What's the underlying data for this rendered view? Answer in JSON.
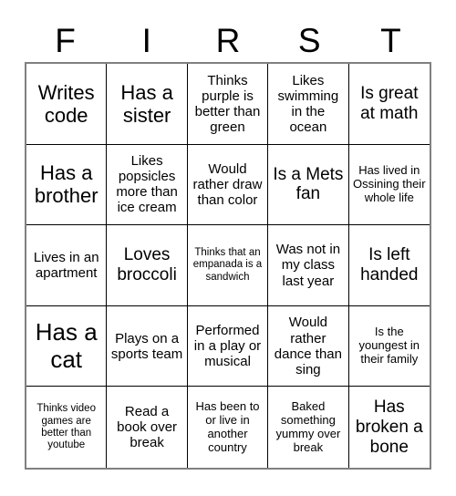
{
  "card": {
    "title_letters": [
      "F",
      "I",
      "R",
      "S",
      "T"
    ],
    "colors": {
      "background": "#ffffff",
      "text": "#000000",
      "cell_border": "#000000",
      "outer_border": "#808080"
    },
    "grid": {
      "columns": 5,
      "rows": 5,
      "cells": [
        {
          "text": "Writes code",
          "size": "lg"
        },
        {
          "text": "Has a sister",
          "size": "lg"
        },
        {
          "text": "Thinks purple is better than green",
          "size": "sm"
        },
        {
          "text": "Likes swimming in the ocean",
          "size": "sm"
        },
        {
          "text": "Is great at math",
          "size": "md"
        },
        {
          "text": "Has a brother",
          "size": "lg"
        },
        {
          "text": "Likes popsicles more than ice cream",
          "size": "sm"
        },
        {
          "text": "Would rather draw than color",
          "size": "sm"
        },
        {
          "text": "Is a Mets fan",
          "size": "md"
        },
        {
          "text": "Has lived in Ossining their whole life",
          "size": "xs"
        },
        {
          "text": "Lives in an apartment",
          "size": "sm"
        },
        {
          "text": "Loves broccoli",
          "size": "md"
        },
        {
          "text": "Thinks that an empanada is a sandwich",
          "size": "xxs"
        },
        {
          "text": "Was not in my class last year",
          "size": "sm"
        },
        {
          "text": "Is left handed",
          "size": "md"
        },
        {
          "text": "Has a cat",
          "size": "xl"
        },
        {
          "text": "Plays on a sports team",
          "size": "sm"
        },
        {
          "text": "Performed in a play or musical",
          "size": "sm"
        },
        {
          "text": "Would rather dance than sing",
          "size": "sm"
        },
        {
          "text": "Is the youngest in their family",
          "size": "xs"
        },
        {
          "text": "Thinks video games are better than youtube",
          "size": "xxs"
        },
        {
          "text": "Read a book over break",
          "size": "sm"
        },
        {
          "text": "Has been to or live in another country",
          "size": "xs"
        },
        {
          "text": "Baked something yummy over break",
          "size": "xs"
        },
        {
          "text": "Has broken a bone",
          "size": "md"
        }
      ]
    }
  }
}
